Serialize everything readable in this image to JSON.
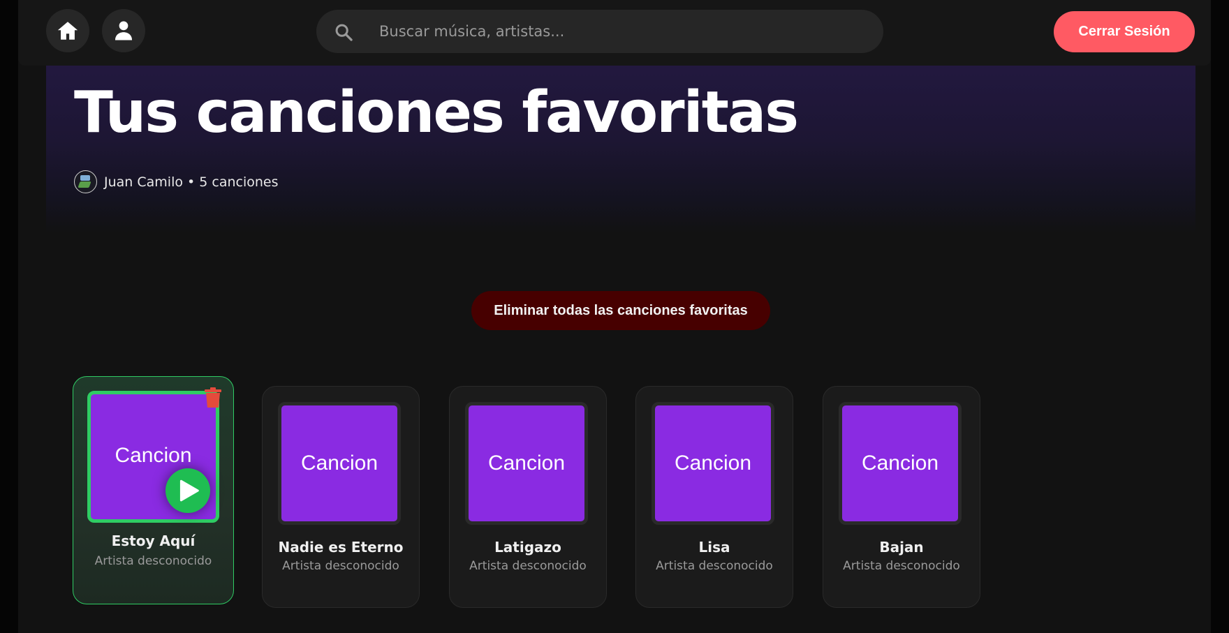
{
  "nav": {
    "home_icon": "home-icon",
    "user_icon": "user-icon",
    "search_icon": "search-icon",
    "search_placeholder": "Buscar música, artistas...",
    "logout_label": "Cerrar Sesión"
  },
  "header": {
    "title": "Tus canciones favoritas",
    "meta": "Juan Camilo • 5 canciones"
  },
  "actions": {
    "delete_all_label": "Eliminar todas las canciones favoritas"
  },
  "songs": [
    {
      "cover_text": "Cancion",
      "title": "Estoy Aquí",
      "artist": "Artista desconocido"
    },
    {
      "cover_text": "Cancion",
      "title": "Nadie es Eterno",
      "artist": "Artista desconocido"
    },
    {
      "cover_text": "Cancion",
      "title": "Latigazo",
      "artist": "Artista desconocido"
    },
    {
      "cover_text": "Cancion",
      "title": "Lisa",
      "artist": "Artista desconocido"
    },
    {
      "cover_text": "Cancion",
      "title": "Bajan",
      "artist": "Artista desconocido"
    }
  ],
  "colors": {
    "accent_green": "#1fbd52",
    "cover_purple": "#8a2be2",
    "logout_red": "#ff5a63",
    "danger_dark_red": "#470000"
  }
}
